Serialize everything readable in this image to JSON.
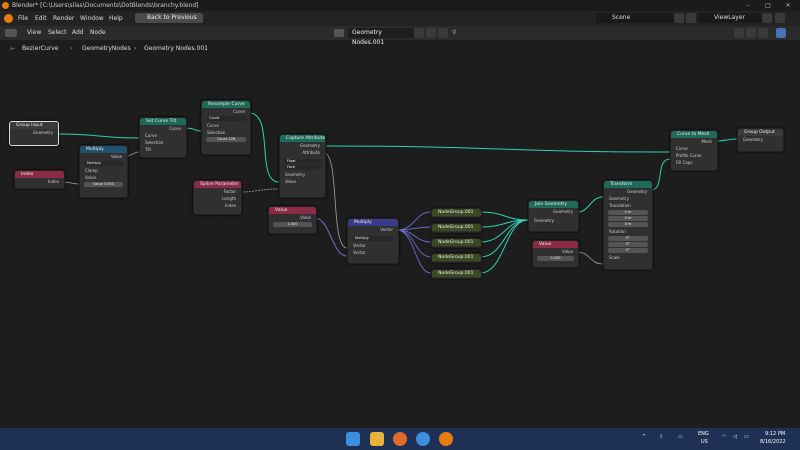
{
  "window": {
    "title": "Blender* [C:\\Users\\silas\\Documents\\DotBlends\\branchy.blend]"
  },
  "menubar": {
    "items": [
      "File",
      "Edit",
      "Render",
      "Window",
      "Help"
    ],
    "back_button": "Back to Previous",
    "scene": "Scene",
    "view_layer": "ViewLayer"
  },
  "editor_header": {
    "menus": [
      "View",
      "Select",
      "Add",
      "Node"
    ],
    "node_tree": "Geometry Nodes.001"
  },
  "breadcrumb": [
    "BezierCurve",
    "GeometryNodes",
    "Geometry Nodes.001"
  ],
  "nodes": {
    "group_input": {
      "title": "Group Input",
      "geometry": "Geometry"
    },
    "index1": {
      "title": "Index",
      "out": "Index"
    },
    "multiply1": {
      "title": "Multiply",
      "value": "Value",
      "op": "Multiply",
      "clamp": "Clamp",
      "in_value": "Value",
      "num": "Value 3.000"
    },
    "set_tilt": {
      "title": "Set Curve Tilt",
      "curve_out": "Curve",
      "curve": "Curve",
      "selection": "Selection",
      "tilt": "Tilt"
    },
    "resample": {
      "title": "Resample Curve",
      "curve_out": "Curve",
      "mode": "Count",
      "curve": "Curve",
      "selection": "Selection",
      "count": "Count 128"
    },
    "spline_param": {
      "title": "Spline Parameter",
      "factor": "Factor",
      "length": "Length",
      "index": "Index"
    },
    "capture": {
      "title": "Capture Attribute",
      "geometry_out": "Geometry",
      "attribute_out": "Attribute",
      "type": "Float",
      "domain": "Face",
      "geometry": "Geometry",
      "value": "Value"
    },
    "value1": {
      "title": "Value",
      "value": "Value",
      "num": "1.000"
    },
    "vmultiply": {
      "title": "Multiply",
      "vector_out": "Vector",
      "op": "Multiply",
      "vec1": "Vector",
      "vec2": "Vector"
    },
    "groups": [
      "NodeGroup.001",
      "NodeGroup.001",
      "NodeGroup.001",
      "NodeGroup.001",
      "NodeGroup.001"
    ],
    "join": {
      "title": "Join Geometry",
      "geometry_out": "Geometry",
      "geometry": "Geometry"
    },
    "value2": {
      "title": "Value",
      "value": "Value",
      "num": "0.200"
    },
    "transform": {
      "title": "Transform",
      "geometry_out": "Geometry",
      "geometry": "Geometry",
      "translation": "Translation",
      "tx": "0 m",
      "ty": "0 m",
      "tz": "0 m",
      "rotation": "Rotation",
      "rx": "0°",
      "ry": "0°",
      "rz": "0°",
      "scale": "Scale"
    },
    "curve_to_mesh": {
      "title": "Curve to Mesh",
      "mesh": "Mesh",
      "curve": "Curve",
      "profile": "Profile Curve",
      "fill": "Fill Caps"
    },
    "group_output": {
      "title": "Group Output",
      "geometry": "Geometry"
    }
  },
  "taskbar": {
    "lang1": "ENG",
    "lang2": "US",
    "time": "9:12 PM",
    "date": "8/16/2022"
  },
  "colors": {
    "geometry_link": "#2fd0b0",
    "vector_link": "#6b6bd0",
    "float_link": "#a0a0a0",
    "accent": "#4772b3"
  }
}
